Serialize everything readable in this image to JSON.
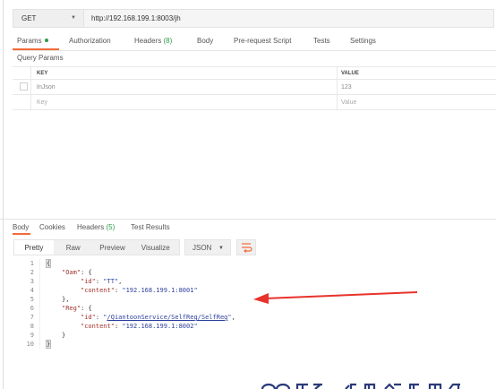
{
  "request": {
    "method": "GET",
    "url": "http://192.168.199.1:8003/jh"
  },
  "request_tabs": [
    {
      "label": "Params",
      "active": true,
      "indicator_dot": true
    },
    {
      "label": "Authorization"
    },
    {
      "label": "Headers",
      "count": "(8)"
    },
    {
      "label": "Body"
    },
    {
      "label": "Pre-request Script"
    },
    {
      "label": "Tests"
    },
    {
      "label": "Settings"
    }
  ],
  "query_params": {
    "title": "Query Params",
    "columns": [
      "KEY",
      "VALUE"
    ],
    "rows": [
      {
        "key": "InJson",
        "value": "123"
      }
    ],
    "placeholder": {
      "key": "Key",
      "value": "Value"
    }
  },
  "response_tabs": [
    {
      "label": "Body",
      "active": true
    },
    {
      "label": "Cookies"
    },
    {
      "label": "Headers",
      "count": "(5)"
    },
    {
      "label": "Test Results"
    }
  ],
  "view_modes": [
    "Pretty",
    "Raw",
    "Preview",
    "Visualize"
  ],
  "active_view_mode": "Pretty",
  "format": "JSON",
  "code": {
    "line_numbers": [
      "1",
      "2",
      "3",
      "4",
      "5",
      "6",
      "7",
      "8",
      "9",
      "10"
    ],
    "t1": "{",
    "t2_key": "\"Oam\"",
    "t2_rest": ": {",
    "t3_key": "\"id\"",
    "t3_sep": ": ",
    "t3_val": "\"TT\"",
    "t3_end": ",",
    "t4_key": "\"content\"",
    "t4_sep": ": ",
    "t4_val": "\"192.168.199.1:8001\"",
    "t5": "},",
    "t6_key": "\"Reg\"",
    "t6_rest": ": {",
    "t7_key": "\"id\"",
    "t7_sep": ": ",
    "t7_q1": "\"",
    "t7_link": "/QiantoonService/SelfReg/SelfReg",
    "t7_q2": "\"",
    "t7_end": ",",
    "t8_key": "\"content\"",
    "t8_sep": ": ",
    "t8_val": "\"192.168.199.1:8002\"",
    "t9": "}",
    "t10": "}"
  },
  "colors": {
    "accent": "#f26b3a",
    "annotation_arrow": "#e8322c",
    "status_green": "#2e9b4a"
  },
  "icons": [
    "chevron-down-icon",
    "wrap-lines-icon",
    "red-annotation-arrow"
  ]
}
